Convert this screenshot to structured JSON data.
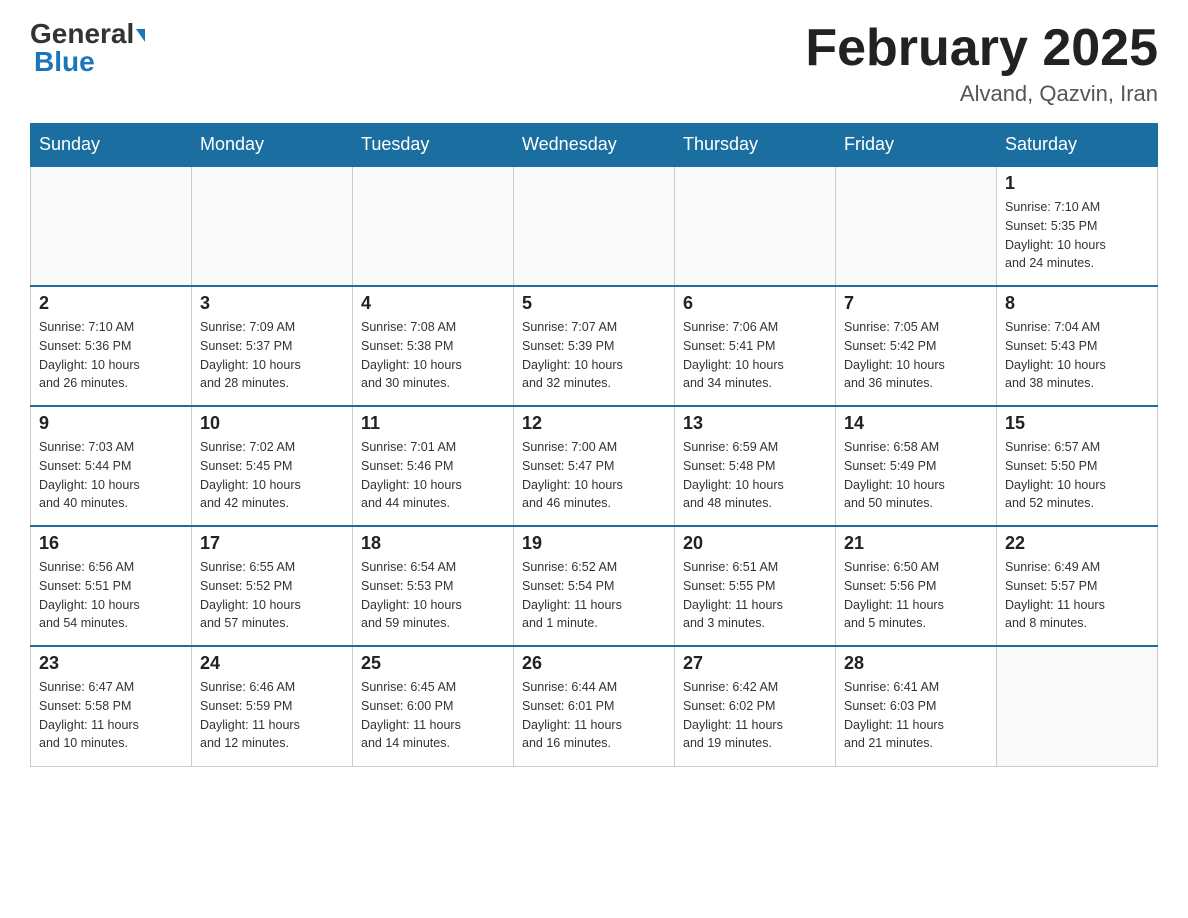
{
  "logo": {
    "general": "General",
    "blue": "Blue"
  },
  "title": "February 2025",
  "location": "Alvand, Qazvin, Iran",
  "days_of_week": [
    "Sunday",
    "Monday",
    "Tuesday",
    "Wednesday",
    "Thursday",
    "Friday",
    "Saturday"
  ],
  "weeks": [
    [
      {
        "day": "",
        "info": ""
      },
      {
        "day": "",
        "info": ""
      },
      {
        "day": "",
        "info": ""
      },
      {
        "day": "",
        "info": ""
      },
      {
        "day": "",
        "info": ""
      },
      {
        "day": "",
        "info": ""
      },
      {
        "day": "1",
        "info": "Sunrise: 7:10 AM\nSunset: 5:35 PM\nDaylight: 10 hours\nand 24 minutes."
      }
    ],
    [
      {
        "day": "2",
        "info": "Sunrise: 7:10 AM\nSunset: 5:36 PM\nDaylight: 10 hours\nand 26 minutes."
      },
      {
        "day": "3",
        "info": "Sunrise: 7:09 AM\nSunset: 5:37 PM\nDaylight: 10 hours\nand 28 minutes."
      },
      {
        "day": "4",
        "info": "Sunrise: 7:08 AM\nSunset: 5:38 PM\nDaylight: 10 hours\nand 30 minutes."
      },
      {
        "day": "5",
        "info": "Sunrise: 7:07 AM\nSunset: 5:39 PM\nDaylight: 10 hours\nand 32 minutes."
      },
      {
        "day": "6",
        "info": "Sunrise: 7:06 AM\nSunset: 5:41 PM\nDaylight: 10 hours\nand 34 minutes."
      },
      {
        "day": "7",
        "info": "Sunrise: 7:05 AM\nSunset: 5:42 PM\nDaylight: 10 hours\nand 36 minutes."
      },
      {
        "day": "8",
        "info": "Sunrise: 7:04 AM\nSunset: 5:43 PM\nDaylight: 10 hours\nand 38 minutes."
      }
    ],
    [
      {
        "day": "9",
        "info": "Sunrise: 7:03 AM\nSunset: 5:44 PM\nDaylight: 10 hours\nand 40 minutes."
      },
      {
        "day": "10",
        "info": "Sunrise: 7:02 AM\nSunset: 5:45 PM\nDaylight: 10 hours\nand 42 minutes."
      },
      {
        "day": "11",
        "info": "Sunrise: 7:01 AM\nSunset: 5:46 PM\nDaylight: 10 hours\nand 44 minutes."
      },
      {
        "day": "12",
        "info": "Sunrise: 7:00 AM\nSunset: 5:47 PM\nDaylight: 10 hours\nand 46 minutes."
      },
      {
        "day": "13",
        "info": "Sunrise: 6:59 AM\nSunset: 5:48 PM\nDaylight: 10 hours\nand 48 minutes."
      },
      {
        "day": "14",
        "info": "Sunrise: 6:58 AM\nSunset: 5:49 PM\nDaylight: 10 hours\nand 50 minutes."
      },
      {
        "day": "15",
        "info": "Sunrise: 6:57 AM\nSunset: 5:50 PM\nDaylight: 10 hours\nand 52 minutes."
      }
    ],
    [
      {
        "day": "16",
        "info": "Sunrise: 6:56 AM\nSunset: 5:51 PM\nDaylight: 10 hours\nand 54 minutes."
      },
      {
        "day": "17",
        "info": "Sunrise: 6:55 AM\nSunset: 5:52 PM\nDaylight: 10 hours\nand 57 minutes."
      },
      {
        "day": "18",
        "info": "Sunrise: 6:54 AM\nSunset: 5:53 PM\nDaylight: 10 hours\nand 59 minutes."
      },
      {
        "day": "19",
        "info": "Sunrise: 6:52 AM\nSunset: 5:54 PM\nDaylight: 11 hours\nand 1 minute."
      },
      {
        "day": "20",
        "info": "Sunrise: 6:51 AM\nSunset: 5:55 PM\nDaylight: 11 hours\nand 3 minutes."
      },
      {
        "day": "21",
        "info": "Sunrise: 6:50 AM\nSunset: 5:56 PM\nDaylight: 11 hours\nand 5 minutes."
      },
      {
        "day": "22",
        "info": "Sunrise: 6:49 AM\nSunset: 5:57 PM\nDaylight: 11 hours\nand 8 minutes."
      }
    ],
    [
      {
        "day": "23",
        "info": "Sunrise: 6:47 AM\nSunset: 5:58 PM\nDaylight: 11 hours\nand 10 minutes."
      },
      {
        "day": "24",
        "info": "Sunrise: 6:46 AM\nSunset: 5:59 PM\nDaylight: 11 hours\nand 12 minutes."
      },
      {
        "day": "25",
        "info": "Sunrise: 6:45 AM\nSunset: 6:00 PM\nDaylight: 11 hours\nand 14 minutes."
      },
      {
        "day": "26",
        "info": "Sunrise: 6:44 AM\nSunset: 6:01 PM\nDaylight: 11 hours\nand 16 minutes."
      },
      {
        "day": "27",
        "info": "Sunrise: 6:42 AM\nSunset: 6:02 PM\nDaylight: 11 hours\nand 19 minutes."
      },
      {
        "day": "28",
        "info": "Sunrise: 6:41 AM\nSunset: 6:03 PM\nDaylight: 11 hours\nand 21 minutes."
      },
      {
        "day": "",
        "info": ""
      }
    ]
  ]
}
